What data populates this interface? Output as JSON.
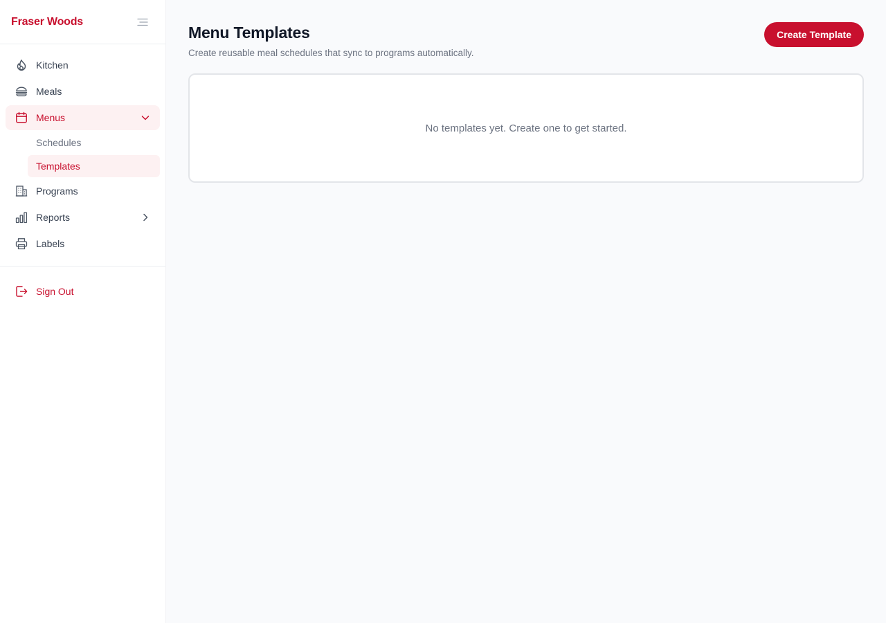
{
  "brand": "Fraser Woods",
  "sidebar": {
    "items": [
      {
        "label": "Kitchen",
        "icon": "flame-icon"
      },
      {
        "label": "Meals",
        "icon": "burger-icon"
      },
      {
        "label": "Menus",
        "icon": "calendar-icon",
        "expanded": true,
        "children": [
          {
            "label": "Schedules"
          },
          {
            "label": "Templates",
            "active": true
          }
        ]
      },
      {
        "label": "Programs",
        "icon": "building-icon"
      },
      {
        "label": "Reports",
        "icon": "bar-chart-icon"
      },
      {
        "label": "Labels",
        "icon": "printer-icon"
      }
    ],
    "sign_out": "Sign Out"
  },
  "page": {
    "title": "Menu Templates",
    "subtitle": "Create reusable meal schedules that sync to programs automatically.",
    "create_button": "Create Template",
    "empty_text": "No templates yet. Create one to get started."
  },
  "colors": {
    "accent": "#c8102e",
    "active_bg": "#fdf1f2"
  }
}
